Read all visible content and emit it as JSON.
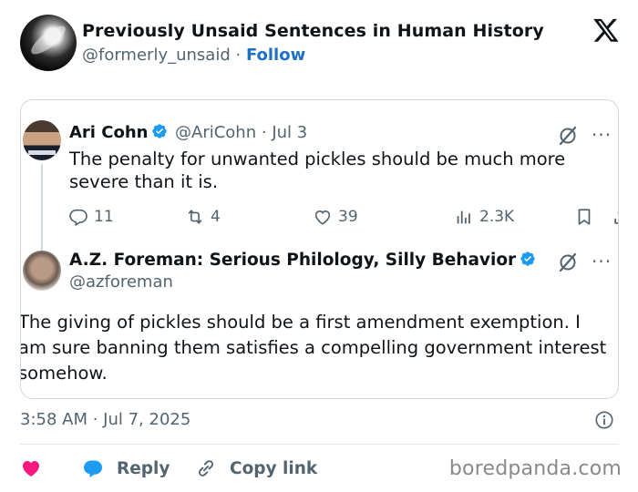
{
  "account": {
    "name": "Previously Unsaid Sentences in Human History",
    "handle": "@formerly_unsaid",
    "separator": "·",
    "follow_label": "Follow"
  },
  "quoted": {
    "tweet1": {
      "name": "Ari Cohn",
      "handle": "@AriCohn",
      "date": "Jul 3",
      "text": "The penalty for unwanted pickles should be much more severe than it is.",
      "replies": "11",
      "retweets": "4",
      "likes": "39",
      "views": "2.3K"
    },
    "tweet2": {
      "name": "A.Z. Foreman: Serious Philology, Silly Behavior",
      "handle": "@azforeman",
      "text": "The giving of pickles should be a first amendment exemption. I am sure banning them satisfies a compelling government interest somehow."
    }
  },
  "timestamp": "3:58 AM · Jul 7, 2025",
  "bottom_bar": {
    "reply_label": "Reply",
    "copy_link_label": "Copy link"
  },
  "watermark": "boredpanda.com",
  "colors": {
    "verified": "#1d9bf0",
    "heart": "#f91880",
    "reply_bubble": "#1d9bf0",
    "follow": "#1d70c4",
    "muted": "#536471"
  },
  "icons": [
    "x-logo-icon",
    "verified-badge-icon",
    "grok-icon",
    "more-icon",
    "reply-icon",
    "retweet-icon",
    "like-icon",
    "views-icon",
    "bookmark-icon",
    "share-icon",
    "info-icon",
    "heart-icon",
    "reply-bubble-icon",
    "link-icon"
  ]
}
